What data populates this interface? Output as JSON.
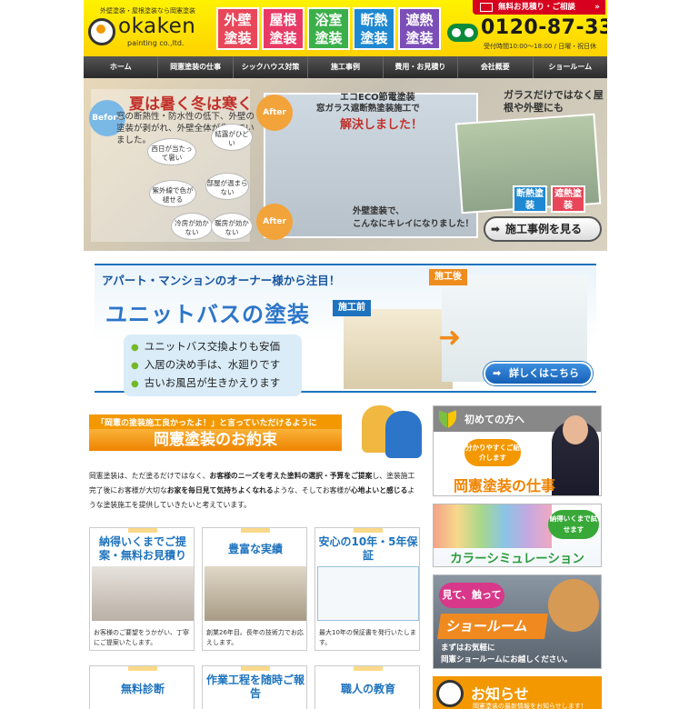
{
  "header": {
    "tagline": "外壁塗装・屋根塗装なら岡憲塗装",
    "logo_text": "okaken",
    "logo_sub": "painting co.,ltd.",
    "services": [
      {
        "line1": "外壁",
        "line2": "塗装",
        "color": "#e8475a"
      },
      {
        "line1": "屋根",
        "line2": "塗装",
        "color": "#e83a66"
      },
      {
        "line1": "浴室",
        "line2": "塗装",
        "color": "#3bb04a"
      },
      {
        "line1": "断熱",
        "line2": "塗装",
        "color": "#1e88d2"
      },
      {
        "line1": "遮熱",
        "line2": "塗装",
        "color": "#7c4fb8"
      }
    ],
    "contact_button": "無料お見積り・ご相談",
    "phone": "0120-87-3355",
    "hours": "受付時間10:00～18:00 / 日曜・祝日休"
  },
  "nav": [
    "ホーム",
    "岡憲塗装の仕事",
    "シックハウス対策",
    "施工事例",
    "費用・お見積り",
    "会社概要",
    "ショールーム"
  ],
  "hero": {
    "title": "夏は暑く冬は寒く",
    "text": "窓の断熱性・防水性の低下、外壁の塗装が剥がれ、外壁全体が傷んでいました。",
    "before": "Before",
    "after": "After",
    "bubbles": [
      "結露がひどい",
      "西日が当たって暑い",
      "部屋が温まらない",
      "紫外線で色が褪せる",
      "冷房が効かない",
      "暖房が効かない"
    ],
    "eco_line1": "エコECO節電塗装",
    "eco_line2": "窓ガラス遮断熱塗装施工で",
    "solved": "解決しました！",
    "glass_note": "ガラスだけではなく屋根や外壁にも",
    "tag1": "断熱塗装",
    "tag2": "遮熱塗装",
    "done_line1": "外壁塗装で、",
    "done_line2": "こんなにキレイになりました！",
    "cases_button": "施工事例を見る",
    "accent": "#c2312b"
  },
  "unit_bath": {
    "heading": "アパート・マンションのオーナー様から注目！",
    "title": "ユニットバスの塗装",
    "features": [
      "ユニットバス交換よりも安価",
      "入居の決め手は、水廻りです",
      "古いお風呂が生きかえります"
    ],
    "before_label": "施工前",
    "after_label": "施工後",
    "detail_button": "詳しくはこちら",
    "accent": "#1e73be"
  },
  "promise": {
    "subtitle": "「岡憲の塗装施工良かったよ！」と言っていただけるように",
    "title": "岡憲塗装のお約束",
    "intro_1": "岡憲塗装は、ただ塗るだけではなく、",
    "intro_b1": "お客様のニーズを考えた塗料の選択・予算をご提案",
    "intro_2": "し、塗装施工完了後にお客様が大切な",
    "intro_b2": "お家を毎日見て気持ちよくなれる",
    "intro_3": "ような、そしてお客様が",
    "intro_b3": "心地よいと感じる",
    "intro_4": "ような塗装施工を提供していきたいと考えています。",
    "features": [
      {
        "title": "納得いくまでご提案・無料お見積り",
        "text": "お客様のご要望をうかがい、丁寧にご提案いたします。"
      },
      {
        "title": "豊富な実績",
        "text": "創業26年目。長年の技術力でお応えします。"
      },
      {
        "title": "安心の10年・5年保証",
        "text": "最大10年の保証書を発行いたします。"
      },
      {
        "title": "無料診断",
        "text": ""
      },
      {
        "title": "作業工程を随時ご報告",
        "text": ""
      },
      {
        "title": "職人の教育",
        "text": ""
      }
    ]
  },
  "sidebar": {
    "work": {
      "head": "初めての方へ",
      "bubble": "分かりやすくご紹介します",
      "title": "岡憲塗装の仕事"
    },
    "color": {
      "bubble": "納得いくまで試せます",
      "title": "カラーシミュレーション"
    },
    "showroom": {
      "bubble": "見て、触って",
      "title": "ショールーム",
      "text_1": "まずはお気軽に",
      "text_2": "岡憲ショールームにお越しください。"
    },
    "news": {
      "title": "お知らせ",
      "sub": "岡憲塗装の最新情報をお知らせします！"
    }
  }
}
